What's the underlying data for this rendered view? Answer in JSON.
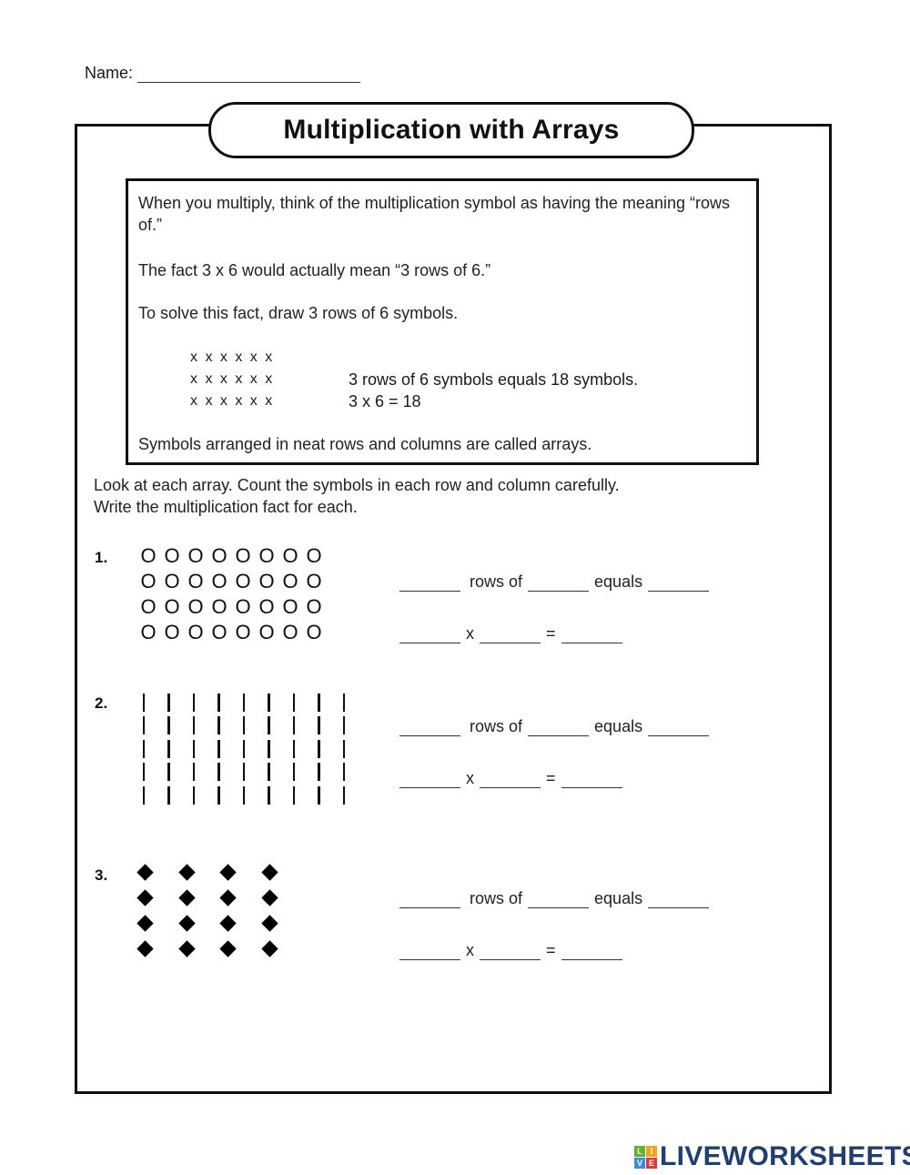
{
  "worksheet": {
    "name_label": "Name:",
    "name_value": "",
    "title": "Multiplication with Arrays"
  },
  "intro": {
    "paragraph1": "When you multiply, think of the multiplication symbol as having the meaning “rows of.”",
    "paragraph2": "The fact 3 x 6 would actually mean “3 rows of 6.”",
    "paragraph3": "To solve this fact, draw 3 rows of 6 symbols.",
    "example_rows": [
      "x x x x x x",
      "x x x x x x",
      "x x x x x x"
    ],
    "example_text": [
      "3 rows of 6 symbols equals 18 symbols.",
      "3 x 6 = 18"
    ],
    "paragraph4": "Symbols arranged in neat rows and columns are called arrays."
  },
  "directions": {
    "line1": "Look at each array.  Count the symbols in each row and column carefully.",
    "line2": "Write the multiplication fact for each."
  },
  "fact_template": {
    "rows_of": "rows of",
    "equals": "equals",
    "times": "x",
    "equals_sign": "="
  },
  "problems": [
    {
      "number": "1.",
      "symbol": "O",
      "symbol_name": "circle",
      "rows": 4,
      "columns": 8,
      "answers": {
        "rows": "",
        "per_row": "",
        "total": "",
        "factor1": "",
        "factor2": "",
        "product": ""
      }
    },
    {
      "number": "2.",
      "symbol": "|",
      "symbol_name": "vertical-bar",
      "rows": 5,
      "columns": 9,
      "answers": {
        "rows": "",
        "per_row": "",
        "total": "",
        "factor1": "",
        "factor2": "",
        "product": ""
      }
    },
    {
      "number": "3.",
      "symbol": "◆",
      "symbol_name": "diamond",
      "rows": 4,
      "columns": 4,
      "answers": {
        "rows": "",
        "per_row": "",
        "total": "",
        "factor1": "",
        "factor2": "",
        "product": ""
      }
    }
  ],
  "branding": {
    "logo_letters": [
      "L",
      "I",
      "V",
      "E"
    ],
    "logo_colors": [
      "#5cb531",
      "#f2a51c",
      "#3d8be0",
      "#e0383d"
    ],
    "logo_text": "LIVEWORKSHEETS",
    "logo_text_color": "#1f3e72"
  }
}
